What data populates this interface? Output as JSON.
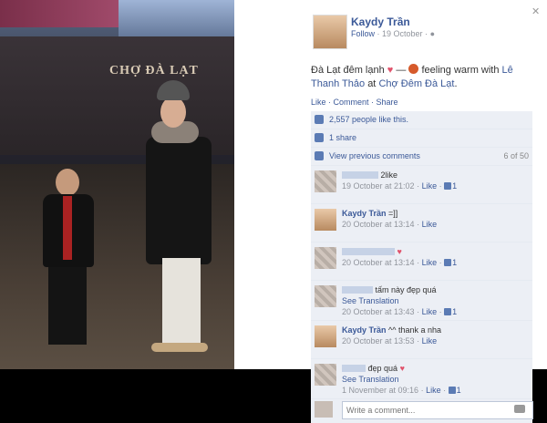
{
  "photo": {
    "sign_text": "CHỢ ĐÀ LẠT"
  },
  "post": {
    "author": "Kaydy Trần",
    "follow": "Follow",
    "date": "· 19 October ·",
    "text_part1": "Đà Lạt đêm lạnh",
    "text_part2": "— ",
    "text_part3": "feeling warm with",
    "tagged_name": "Lê Thanh Thảo",
    "at_word": "at",
    "place": "Chợ Đêm Đà Lạt",
    "actions": "Like · Comment · Share"
  },
  "ufi": {
    "likes": "2,557 people like this.",
    "shares": "1 share",
    "view_prev": "View previous comments",
    "count": "6 of 50"
  },
  "comments": [
    {
      "name": "",
      "text": "2like",
      "time": "19 October at 21:02",
      "like": "Like",
      "likes": "1",
      "author_avatar": false,
      "heart": false,
      "translation": ""
    },
    {
      "name": "Kaydy Trần",
      "text": "=]]",
      "time": "20 October at 13:14",
      "like": "Like",
      "likes": "",
      "author_avatar": true,
      "heart": false,
      "translation": ""
    },
    {
      "name": "",
      "text": "",
      "time": "20 October at 13:14",
      "like": "Like",
      "likes": "1",
      "author_avatar": false,
      "heart": true,
      "translation": ""
    },
    {
      "name": "",
      "text": "tấm này đẹp quá",
      "time": "20 October at 13:43",
      "like": "Like",
      "likes": "1",
      "author_avatar": false,
      "heart": false,
      "translation": "See Translation"
    },
    {
      "name": "Kaydy Trần",
      "text": "^^ thank a nha",
      "time": "20 October at 13:53",
      "like": "Like",
      "likes": "",
      "author_avatar": true,
      "heart": false,
      "translation": ""
    },
    {
      "name": "",
      "text": "đẹp quá",
      "time": "1 November at 09:16",
      "like": "Like",
      "likes": "1",
      "author_avatar": false,
      "heart": true,
      "translation": "See Translation"
    }
  ],
  "composer": {
    "placeholder": "Write a comment..."
  },
  "colors": {
    "link": "#3b5998",
    "heart": "#e0526b"
  },
  "icons": [
    "globe-icon",
    "heart-icon",
    "feeling-emoji-icon",
    "like-thumb-icon",
    "share-icon",
    "comment-icon",
    "camera-icon",
    "close-icon"
  ]
}
